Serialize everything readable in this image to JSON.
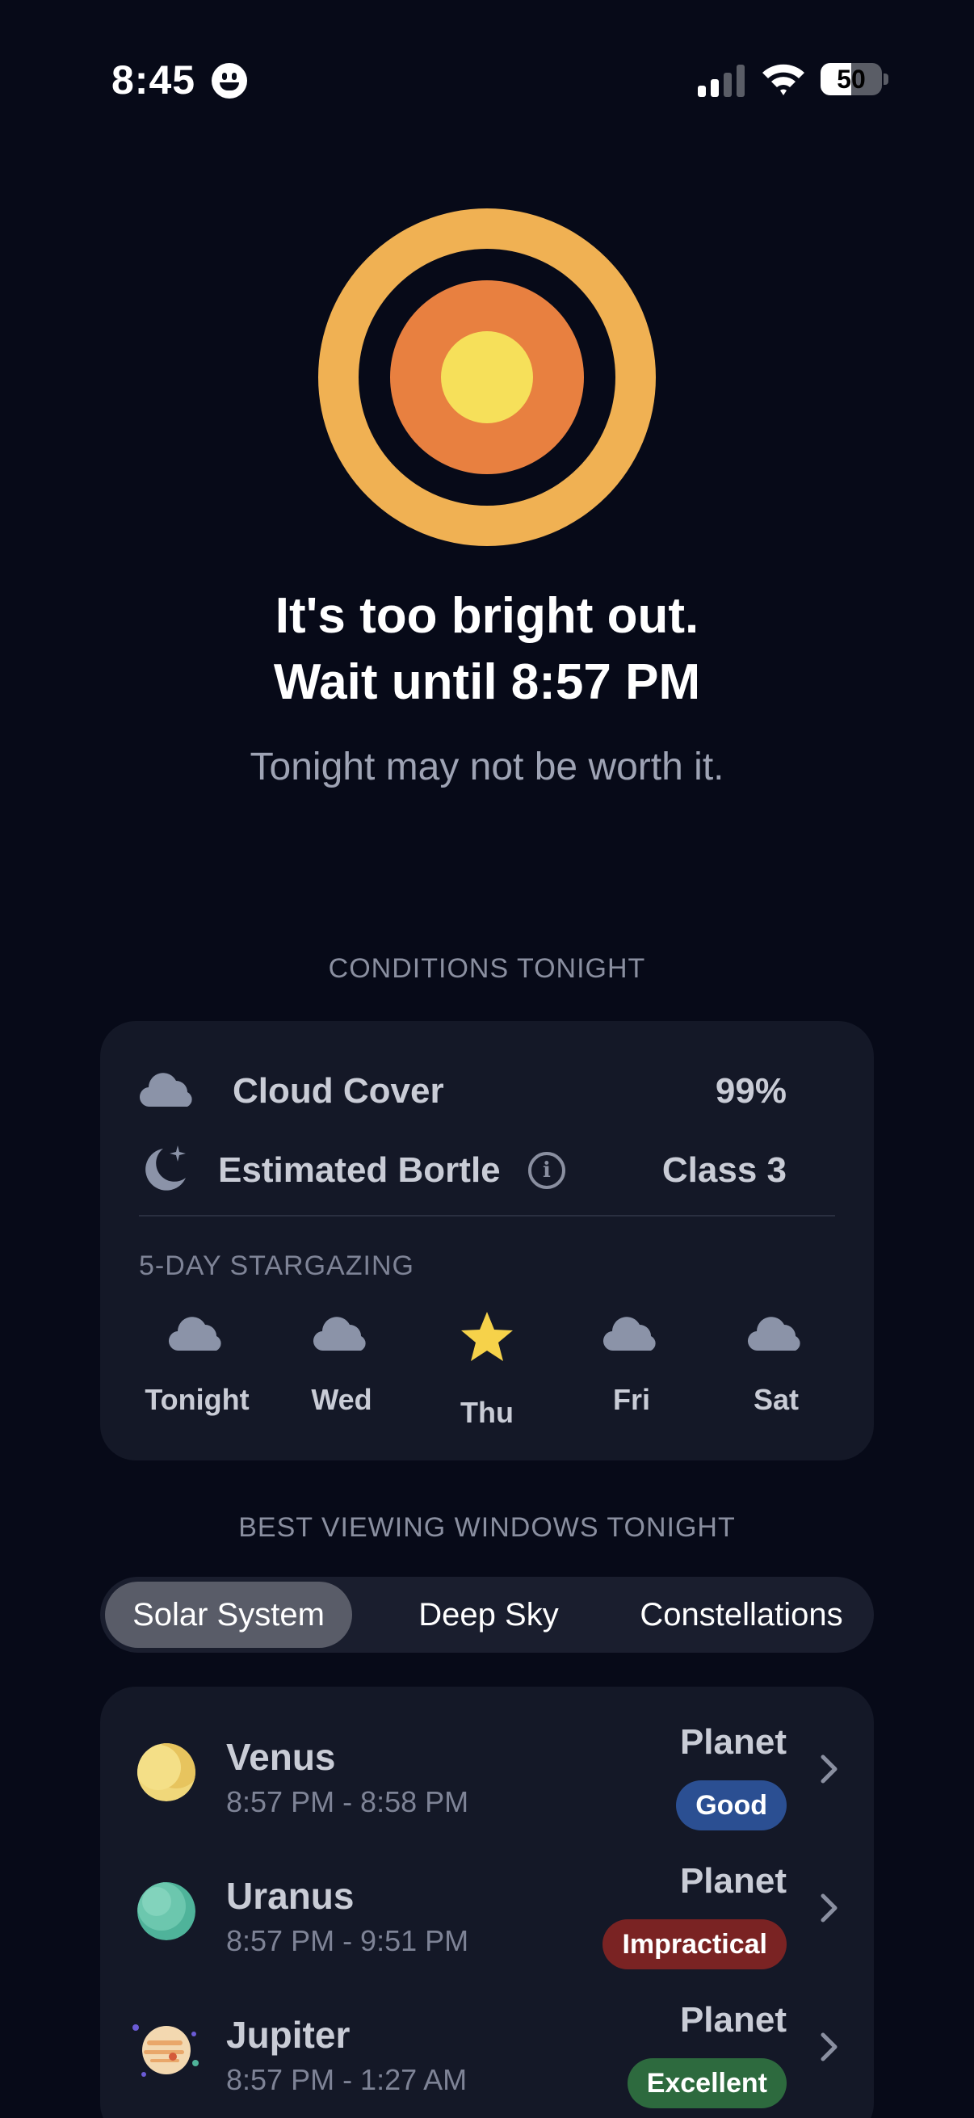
{
  "status_bar": {
    "time": "8:45",
    "battery_level": "50",
    "battery_fraction": 0.5,
    "signal_bars_active": 2,
    "signal_bars_total": 4
  },
  "hero": {
    "icon": "sun-brightness-rings",
    "headline_line1": "It's too bright out.",
    "headline_line2": "Wait until 8:57 PM",
    "subline": "Tonight may not be worth it."
  },
  "conditions": {
    "section_title": "CONDITIONS TONIGHT",
    "cloud_cover": {
      "label": "Cloud Cover",
      "value": "99%",
      "icon": "cloud-icon"
    },
    "bortle": {
      "label": "Estimated Bortle",
      "value": "Class 3",
      "icon": "moon-stars-icon",
      "info_icon": "i"
    },
    "forecast_title": "5-DAY STARGAZING",
    "forecast": [
      {
        "day": "Tonight",
        "icon": "cloud-icon"
      },
      {
        "day": "Wed",
        "icon": "cloud-icon"
      },
      {
        "day": "Thu",
        "icon": "star-icon"
      },
      {
        "day": "Fri",
        "icon": "cloud-icon"
      },
      {
        "day": "Sat",
        "icon": "cloud-icon"
      }
    ]
  },
  "viewing": {
    "section_title": "BEST VIEWING WINDOWS TONIGHT",
    "tabs": [
      {
        "label": "Solar System",
        "active": true
      },
      {
        "label": "Deep Sky",
        "active": false
      },
      {
        "label": "Constellations",
        "active": false
      }
    ],
    "objects": [
      {
        "name": "Venus",
        "time": "8:57 PM - 8:58 PM",
        "type": "Planet",
        "rating": "Good",
        "rating_color": "#2b4f92",
        "icon": "venus-planet-icon"
      },
      {
        "name": "Uranus",
        "time": "8:57 PM - 9:51 PM",
        "type": "Planet",
        "rating": "Impractical",
        "rating_color": "#7a2323",
        "icon": "uranus-planet-icon"
      },
      {
        "name": "Jupiter",
        "time": "8:57 PM - 1:27 AM",
        "type": "Planet",
        "rating": "Excellent",
        "rating_color": "#2d6a3e",
        "icon": "jupiter-planet-icon"
      }
    ]
  },
  "colors": {
    "background": "#070a18",
    "card": "#141827",
    "sun_outer": "#f0b153",
    "sun_inner": "#e88040",
    "sun_core": "#f6e05a",
    "star": "#f6d24a",
    "cloud": "#8b93a8"
  }
}
